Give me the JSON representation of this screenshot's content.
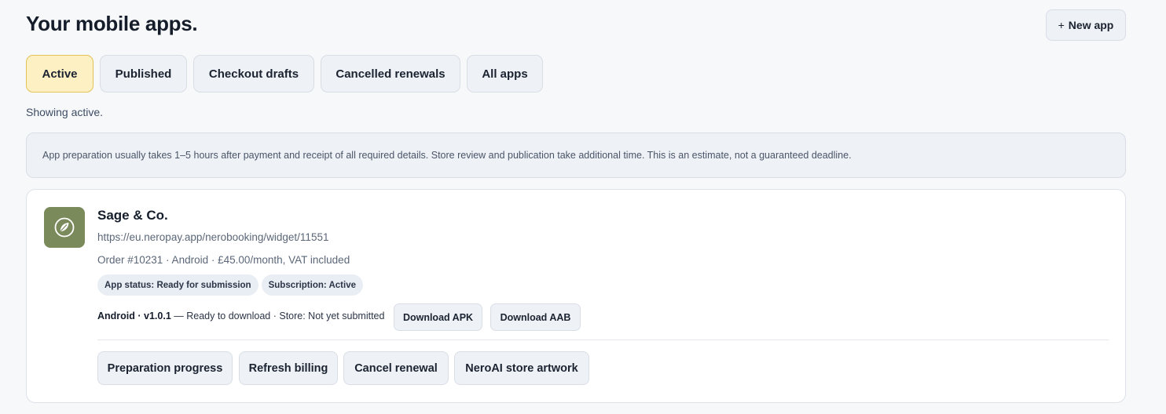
{
  "header": {
    "title": "Your mobile apps.",
    "new_app_icon": "plus-icon",
    "new_app_label": "New app"
  },
  "tabs": [
    {
      "label": "Active",
      "active": true
    },
    {
      "label": "Published",
      "active": false
    },
    {
      "label": "Checkout drafts",
      "active": false
    },
    {
      "label": "Cancelled renewals",
      "active": false
    },
    {
      "label": "All apps",
      "active": false
    }
  ],
  "filter_status": "Showing active.",
  "notice": "App preparation usually takes 1–5 hours after payment and receipt of all required details. Store review and publication take additional time. This is an estimate, not a guaranteed deadline.",
  "app": {
    "icon": "leaf-icon",
    "icon_color": "#7a8a5b",
    "name": "Sage & Co.",
    "url": "https://eu.neropay.app/nerobooking/widget/11551",
    "order_line": "Order #10231 · Android · £45.00/month, VAT included",
    "badges": [
      {
        "label": "App status: Ready for submission"
      },
      {
        "label": "Subscription: Active"
      }
    ],
    "release": {
      "platform_version": "Android · v1.0.1",
      "status": " — Ready to download · Store: Not yet submitted"
    },
    "downloads": [
      {
        "label": "Download APK"
      },
      {
        "label": "Download AAB"
      }
    ],
    "actions": [
      {
        "label": "Preparation progress"
      },
      {
        "label": "Refresh billing"
      },
      {
        "label": "Cancel renewal"
      },
      {
        "label": "NeroAI store artwork"
      }
    ]
  },
  "colors": {
    "background": "#f7f8fa",
    "active_tab": "#fdf1c4",
    "active_tab_border": "#e3c25a",
    "button": "#eef1f5",
    "badge": "#e9eef4"
  }
}
